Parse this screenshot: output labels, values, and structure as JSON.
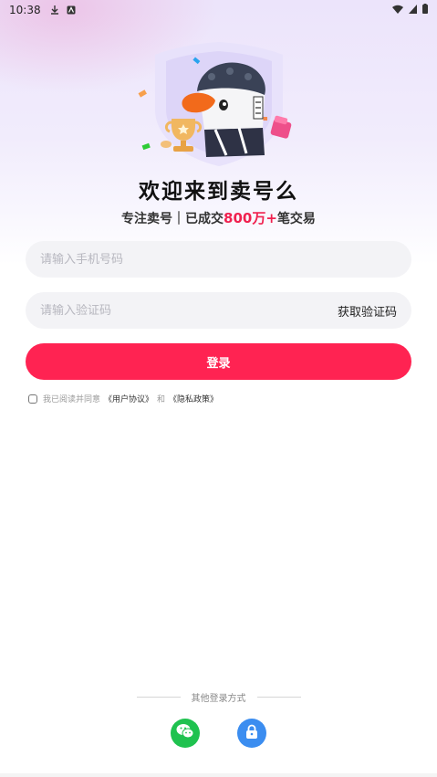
{
  "status_bar": {
    "time": "10:38"
  },
  "hero": {
    "icons": [
      "shield-badge",
      "goose-mascot",
      "trophy-cup",
      "gift-box",
      "confetti"
    ]
  },
  "title": "欢迎来到卖号么",
  "subtitle": {
    "prefix": "专注卖号｜已成交",
    "highlight": "800万+",
    "suffix": "笔交易"
  },
  "form": {
    "phone_placeholder": "请输入手机号码",
    "code_placeholder": "请输入验证码",
    "get_code_label": "获取验证码",
    "login_label": "登录"
  },
  "agreement": {
    "prefix": "我已阅读并同意",
    "user_agreement": "《用户协议》",
    "conjunction": "和",
    "privacy_policy": "《隐私政策》"
  },
  "other_login": {
    "label": "其他登录方式",
    "methods": [
      "wechat-icon",
      "lock-icon"
    ]
  },
  "colors": {
    "accent": "#ff2352",
    "wechat": "#1fc24f",
    "lock": "#3b8df0"
  }
}
